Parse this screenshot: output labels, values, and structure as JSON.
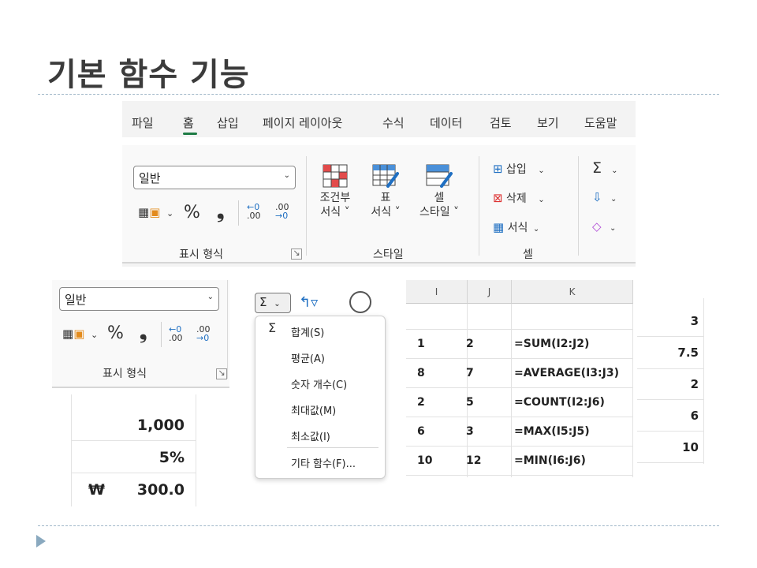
{
  "slide": {
    "title": "기본 함수 기능"
  },
  "ribbon": {
    "tabs": [
      "파일",
      "홈",
      "삽입",
      "페이지 레이아웃",
      "수식",
      "데이터",
      "검토",
      "보기",
      "도움말"
    ],
    "active_tab": "홈",
    "number_group": {
      "format_value": "일반",
      "percent_symbol": "%",
      "comma_symbol": "❟",
      "dec_increase_top": "←0",
      "dec_increase_bottom": ".00",
      "dec_decrease_top": ".00",
      "dec_decrease_bottom": "→0",
      "label": "표시 형식"
    },
    "styles_group": {
      "conditional_line1": "조건부",
      "conditional_line2": "서식 ˅",
      "table_line1": "표",
      "table_line2": "서식 ˅",
      "cell_line1": "셀",
      "cell_line2": "스타일 ˅",
      "label": "스타일"
    },
    "cells_group": {
      "insert": "삽입",
      "delete": "삭제",
      "format": "서식",
      "label": "셀"
    },
    "editing_group": {
      "sum_icon": "Σ"
    }
  },
  "number_snippet": {
    "format_value": "일반",
    "percent_symbol": "%",
    "comma_symbol": "❟",
    "dec_increase_top": "←0",
    "dec_increase_bottom": ".00",
    "dec_decrease_top": ".00",
    "dec_decrease_bottom": "→0",
    "label": "표시 형식"
  },
  "value_cells": {
    "v1": "1,000",
    "v2": "5%",
    "currency": "₩",
    "v3": "300.0"
  },
  "autosum_menu": {
    "button_symbol": "Σ",
    "items": [
      {
        "label": "합계(S)",
        "symbol": "Σ"
      },
      {
        "label": "평균(A)"
      },
      {
        "label": "숫자 개수(C)"
      },
      {
        "label": "최대값(M)"
      },
      {
        "label": "최소값(I)"
      },
      {
        "label": "기타 함수(F)..."
      }
    ]
  },
  "sheet": {
    "columns": [
      "I",
      "J",
      "K"
    ],
    "rows": [
      [
        "1",
        "2",
        "=SUM(I2:J2)"
      ],
      [
        "8",
        "7",
        "=AVERAGE(I3:J3)"
      ],
      [
        "2",
        "5",
        "=COUNT(I2:J6)"
      ],
      [
        "6",
        "3",
        "=MAX(I5:J5)"
      ],
      [
        "10",
        "12",
        "=MIN(I6:J6)"
      ]
    ],
    "results": [
      "3",
      "7.5",
      "2",
      "6",
      "10"
    ]
  },
  "colors": {
    "accent": "#1e7b45",
    "blue": "#1f6fc2",
    "title": "#3b3b3b"
  }
}
